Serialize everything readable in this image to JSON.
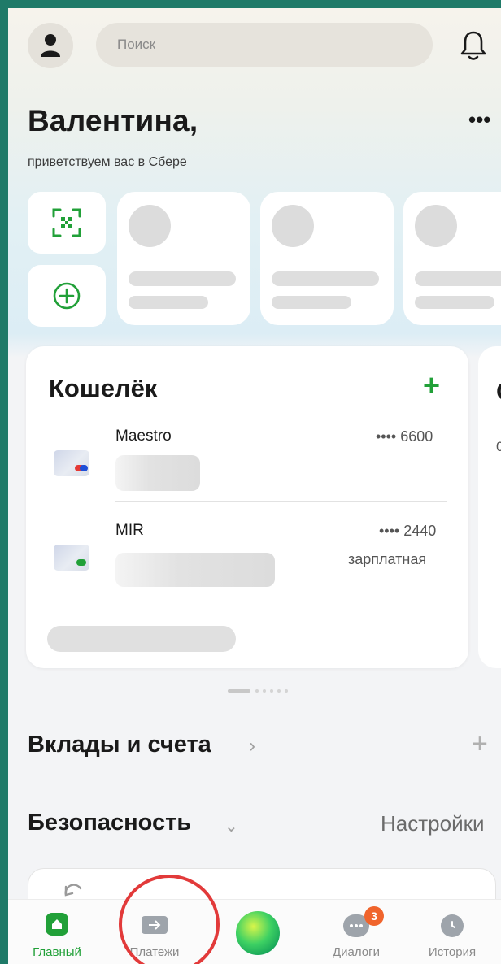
{
  "header": {
    "search_placeholder": "Поиск",
    "greeting": "Валентина,",
    "subtitle": "приветствуем вас в Сбере",
    "more_label": "•••"
  },
  "wallet": {
    "title": "Кошелёк",
    "add_label": "+",
    "cards": [
      {
        "name": "Maestro",
        "mask": "•••• 6600",
        "type": ""
      },
      {
        "name": "MIR",
        "mask": "•••• 2440",
        "type": "зарплатная"
      }
    ]
  },
  "next_card": {
    "title_letter": "С",
    "sub_letter": "0"
  },
  "sections": {
    "deposits_title": "Вклады и счета",
    "deposits_chevron": "›",
    "deposits_add": "+",
    "security_title": "Безопасность",
    "security_chevron": "⌄",
    "security_settings": "Настройки"
  },
  "bottom_nav": {
    "items": [
      {
        "label": "Главный",
        "icon": "home-icon",
        "active": true
      },
      {
        "label": "Платежи",
        "icon": "payments-icon",
        "active": false
      },
      {
        "label": "",
        "icon": "assistant-icon",
        "active": false
      },
      {
        "label": "Диалоги",
        "icon": "chat-icon",
        "active": false,
        "badge": "3"
      },
      {
        "label": "История",
        "icon": "history-icon",
        "active": false
      }
    ]
  },
  "colors": {
    "accent_green": "#21a038",
    "badge_orange": "#f0642c",
    "annotation_red": "#e23a3a",
    "frame_teal": "#1f7a68"
  }
}
